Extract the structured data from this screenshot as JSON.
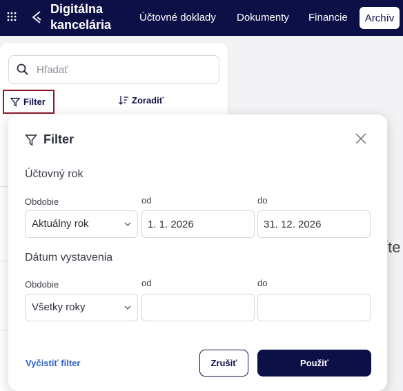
{
  "header": {
    "app_title": "Digitálna kancelária",
    "nav": [
      {
        "label": "Účtovné doklady"
      },
      {
        "label": "Dokumenty"
      },
      {
        "label": "Financie"
      },
      {
        "label": "Archív",
        "active": true
      }
    ],
    "bg_color": "#0d0f47"
  },
  "list_panel": {
    "search_placeholder": "Hľadať",
    "filter_label": "Filter",
    "sort_label": "Zoradiť",
    "truncated_bg_text": "íte"
  },
  "filter_modal": {
    "title": "Filter",
    "sections": [
      {
        "title": "Účtovný rok",
        "period_label": "Obdobie",
        "period_value": "Aktuálny rok",
        "from_label": "od",
        "from_value": "1. 1. 2026",
        "to_label": "do",
        "to_value": "31. 12. 2026"
      },
      {
        "title": "Dátum vystavenia",
        "period_label": "Obdobie",
        "period_value": "Všetky roky",
        "from_label": "od",
        "from_value": "",
        "to_label": "do",
        "to_value": ""
      }
    ],
    "clear_label": "Vyčistiť filter",
    "cancel_label": "Zrušiť",
    "apply_label": "Použiť"
  },
  "colors": {
    "primary": "#0d0f47",
    "link": "#2f5fd0",
    "focus_outline": "#8b1c2b"
  }
}
